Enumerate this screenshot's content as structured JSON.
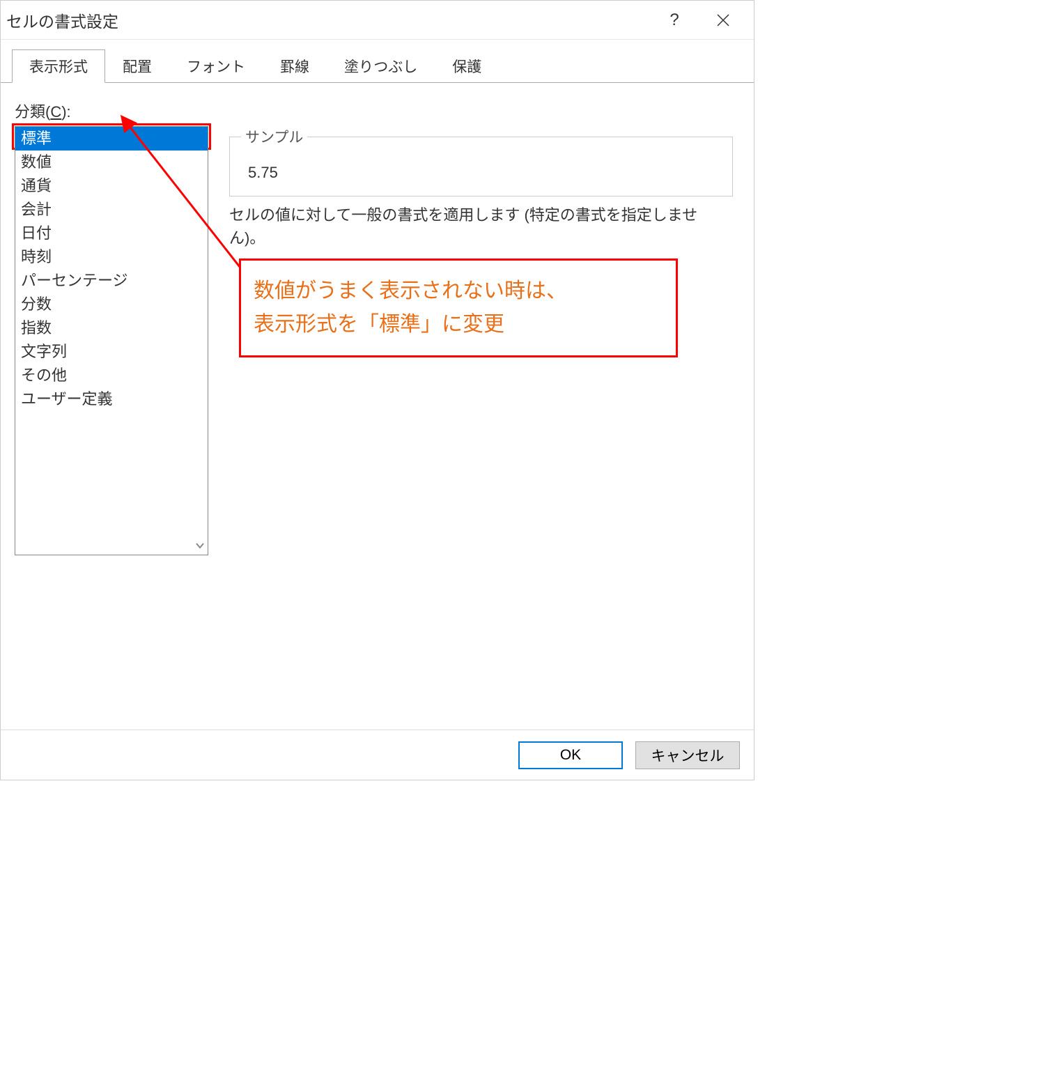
{
  "dialog": {
    "title": "セルの書式設定"
  },
  "tabs": {
    "items": [
      {
        "label": "表示形式",
        "active": true
      },
      {
        "label": "配置",
        "active": false
      },
      {
        "label": "フォント",
        "active": false
      },
      {
        "label": "罫線",
        "active": false
      },
      {
        "label": "塗りつぶし",
        "active": false
      },
      {
        "label": "保護",
        "active": false
      }
    ]
  },
  "category": {
    "label_prefix": "分類(",
    "label_key": "C",
    "label_suffix": "):",
    "items": [
      "標準",
      "数値",
      "通貨",
      "会計",
      "日付",
      "時刻",
      "パーセンテージ",
      "分数",
      "指数",
      "文字列",
      "その他",
      "ユーザー定義"
    ],
    "selected_index": 0
  },
  "sample": {
    "label": "サンプル",
    "value": "5.75"
  },
  "description": "セルの値に対して一般の書式を適用します (特定の書式を指定しません)。",
  "annotation": {
    "line1": "数値がうまく表示されない時は、",
    "line2": "表示形式を「標準」に変更"
  },
  "footer": {
    "ok": "OK",
    "cancel": "キャンセル"
  }
}
